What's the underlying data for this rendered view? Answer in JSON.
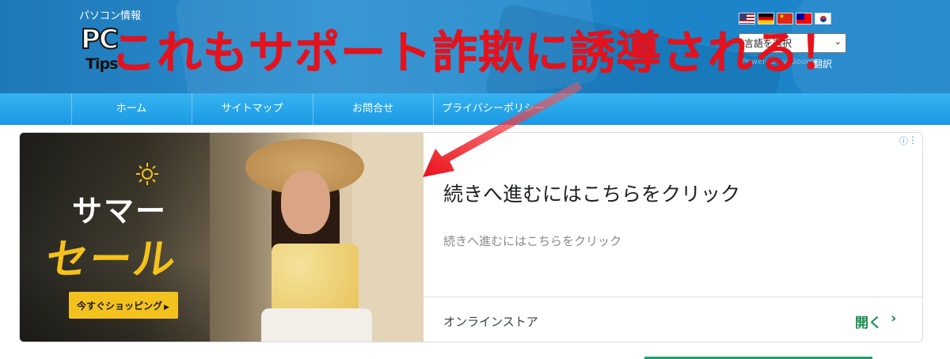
{
  "header": {
    "site_subtitle": "パソコン情報",
    "logo_pc": "PC",
    "logo_tips": "Tips",
    "language_select_value": "言語を選択",
    "powered_by": "Powered by Google",
    "translate_link": "翻訳",
    "flags": [
      "us-flag-icon",
      "germany-flag-icon",
      "china-flag-icon",
      "taiwan-flag-icon",
      "korea-flag-icon"
    ]
  },
  "overlay_title": "これもサポート詐欺に誘導される！",
  "nav": {
    "items": [
      {
        "label": "ホーム"
      },
      {
        "label": "サイトマップ"
      },
      {
        "label": "お問合せ"
      },
      {
        "label": "プライバシーポリシー"
      }
    ]
  },
  "ad": {
    "image_text_line1": "サマー",
    "image_text_line2": "セール",
    "image_cta": "今すぐショッピング",
    "headline": "続きへ進むにはこちらをクリック",
    "description": "続きへ進むにはこちらをクリック",
    "store_name": "オンラインストア",
    "open_label": "開く",
    "info_icon": "info-icon",
    "menu_icon": "more-vert-icon"
  },
  "colors": {
    "header_blue": "#1f78b8",
    "nav_blue": "#1a99e4",
    "overlay_red": "#e8101a",
    "ad_green": "#1a8e4f",
    "sale_yellow": "#f5c21c"
  }
}
